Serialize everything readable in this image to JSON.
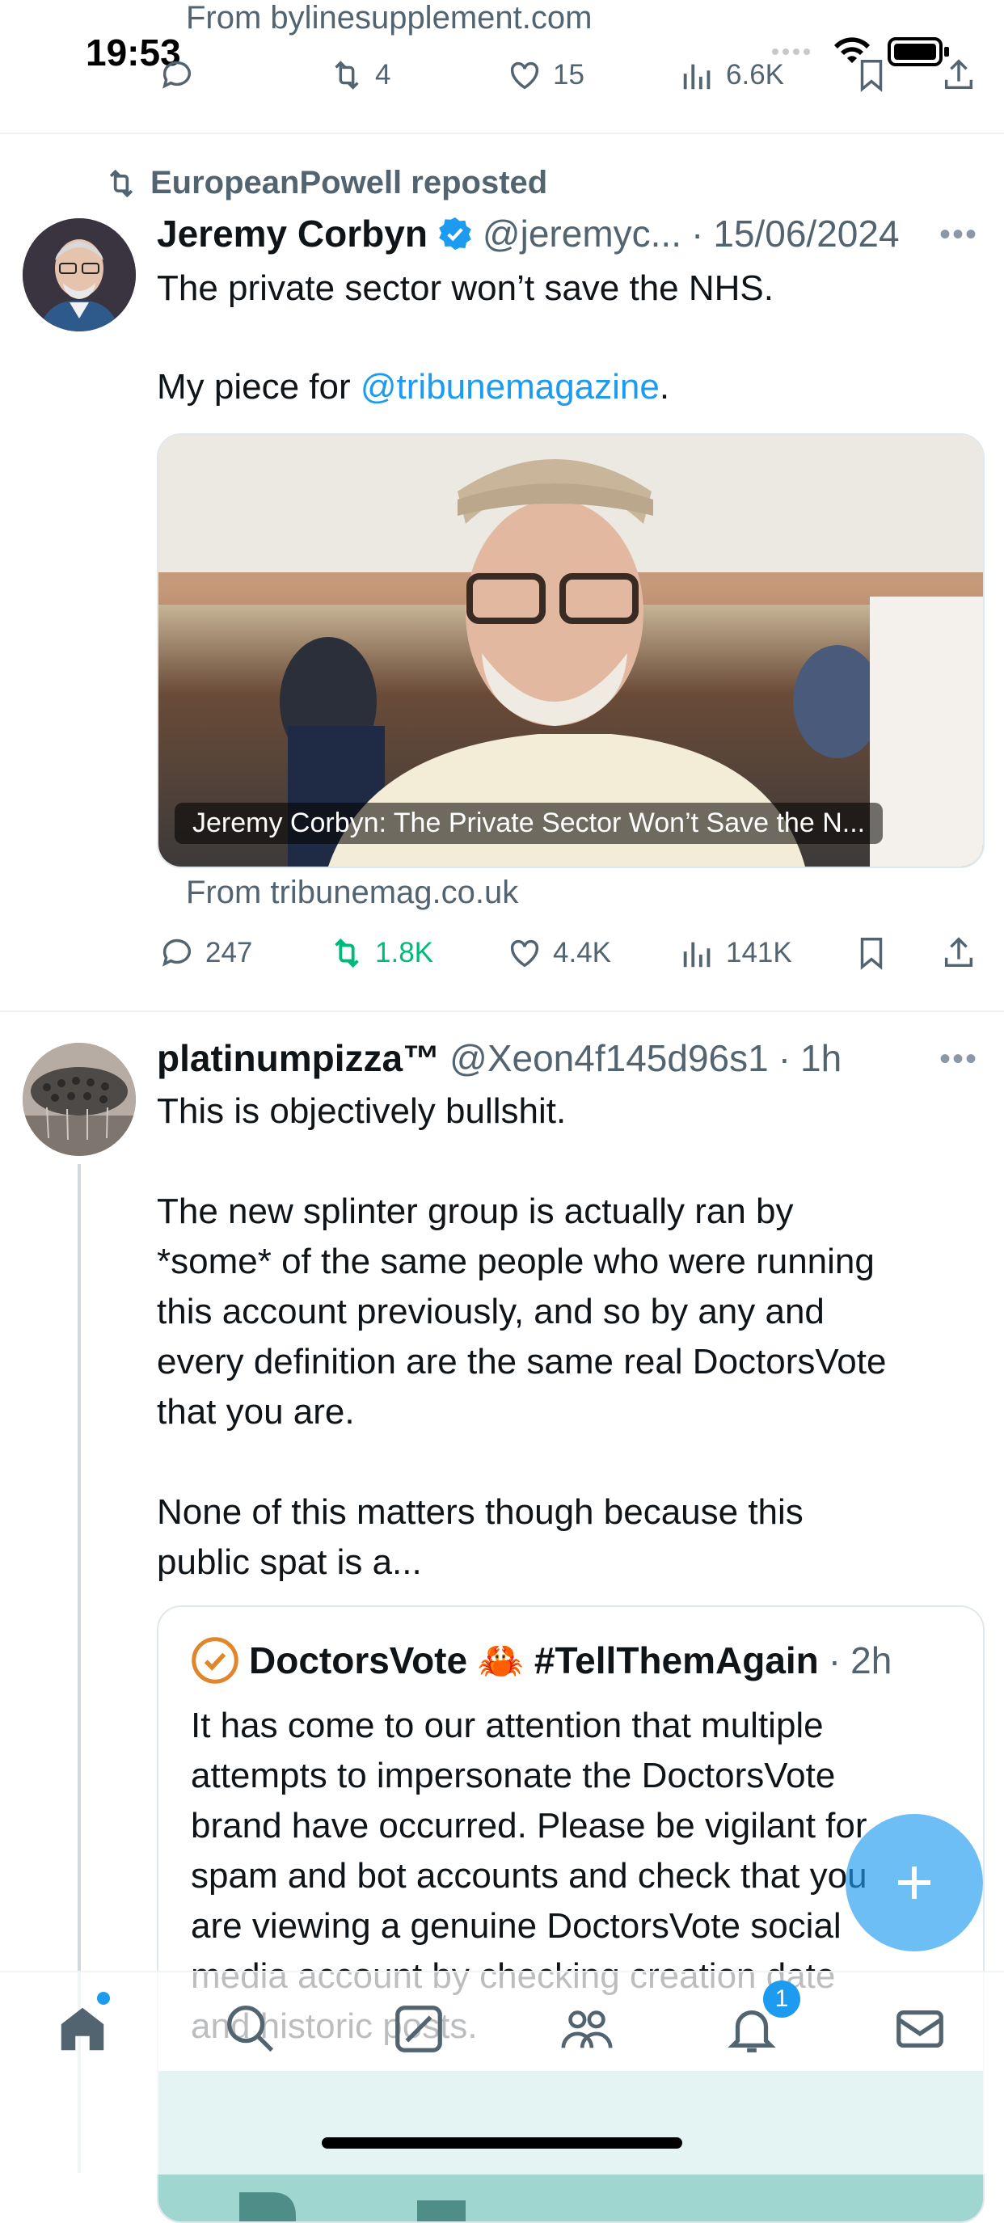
{
  "status_bar": {
    "time": "19:53"
  },
  "top_tweet_fragment": {
    "from_line": "From bylinesupplement.com",
    "retweets": "4",
    "likes": "15",
    "views": "6.6K"
  },
  "tweet1": {
    "repost_label": "EuropeanPowell reposted",
    "author_name": "Jeremy Corbyn",
    "handle": "@jeremyc...",
    "separator": "·",
    "date": "15/06/2024",
    "text_line1": "The private sector won’t save the NHS.",
    "text_prefix": "My piece for ",
    "mention": "@tribunemagazine",
    "text_suffix": ".",
    "card_title": "Jeremy Corbyn: The Private Sector Won’t Save the N...",
    "card_source": "From tribunemag.co.uk",
    "replies": "247",
    "retweets": "1.8K",
    "likes": "4.4K",
    "views": "141K"
  },
  "tweet2": {
    "author_name": "platinumpizza™",
    "handle": "@Xeon4f145d96s1",
    "separator": "·",
    "time": "1h",
    "text": "This is objectively bullshit.\n\nThe new splinter group is actually ran by\n*some* of the same people who were running\nthis account previously, and so by any and\nevery definition are the same real DoctorsVote\nthat you are.\n\nNone of this matters though because this\npublic spat is a...",
    "quote": {
      "author_name": "DoctorsVote 🦀 #TellThemAgain",
      "separator": "·",
      "time": "2h",
      "text": "It has come to our attention that multiple\nattempts to impersonate the DoctorsVote\nbrand have occurred. Please be vigilant for\nspam and bot accounts and check that you\nare viewing a genuine DoctorsVote social\nmedia account by checking creation date\nand historic posts."
    }
  },
  "bottom_nav": {
    "notification_count": "1"
  },
  "colors": {
    "accent": "#1d9bf0",
    "retweet_green": "#00ba7c",
    "verified_blue": "#1d9bf0",
    "verified_gold": "#e0872c"
  }
}
